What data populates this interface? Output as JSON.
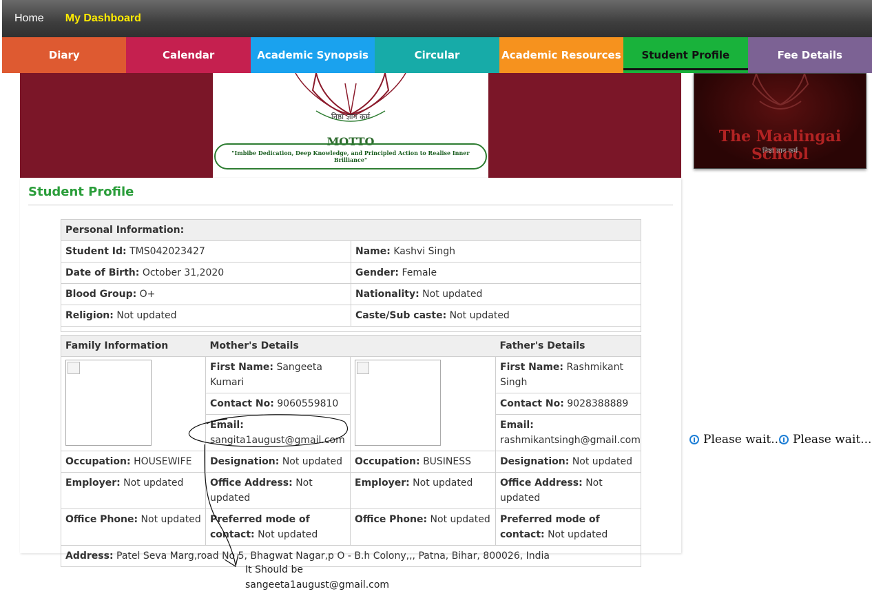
{
  "topbar": {
    "home": "Home",
    "dashboard": "My Dashboard"
  },
  "tabs": [
    {
      "label": "Diary",
      "color": "#de5a31"
    },
    {
      "label": "Calendar",
      "color": "#c5204f"
    },
    {
      "label": "Academic Synopsis",
      "color": "#1aa2ee"
    },
    {
      "label": "Circular",
      "color": "#17aba8"
    },
    {
      "label": "Academic Resources",
      "color": "#f6921e"
    },
    {
      "label": "Student Profile",
      "color": "#19b23b"
    },
    {
      "label": "Fee Details",
      "color": "#7c6294"
    }
  ],
  "banner": {
    "motto_label": "MOTTO",
    "motto_text": "\"Imbibe Dedication, Deep Knowledge, and Principled Action to Realise Inner Brilliance\"",
    "sanskrit": "निष्ठा ज्ञान कर्म"
  },
  "logo": {
    "school_name": "The Maalingai School",
    "tagline": "निष्ठा ज्ञान कर्म"
  },
  "page": {
    "title": "Student Profile"
  },
  "personal": {
    "header": "Personal Information:",
    "student_id_label": "Student Id:",
    "student_id": "TMS042023427",
    "name_label": "Name:",
    "name": "Kashvi Singh",
    "dob_label": "Date of Birth:",
    "dob": "October 31,2020",
    "gender_label": "Gender:",
    "gender": "Female",
    "blood_label": "Blood Group:",
    "blood": "O+",
    "nationality_label": "Nationality:",
    "nationality": "Not updated",
    "religion_label": "Religion:",
    "religion": "Not updated",
    "caste_label": "Caste/Sub caste:",
    "caste": "Not updated"
  },
  "family": {
    "header": "Family Information",
    "mother_header": "Mother's Details",
    "father_header": "Father's Details",
    "mother": {
      "first_name_label": "First Name:",
      "first_name": "Sangeeta Kumari",
      "contact_label": "Contact No:",
      "contact": "9060559810",
      "email_label": "Email:",
      "email": "sangita1august@gmail.com",
      "occupation_label": "Occupation:",
      "occupation": "HOUSEWIFE",
      "designation_label": "Designation:",
      "designation": "Not updated",
      "employer_label": "Employer:",
      "employer": "Not updated",
      "office_address_label": "Office Address:",
      "office_address": "Not updated",
      "office_phone_label": "Office Phone:",
      "office_phone": "Not updated",
      "preferred_label": "Preferred mode of contact:",
      "preferred": "Not updated"
    },
    "father": {
      "first_name_label": "First Name:",
      "first_name": "Rashmikant Singh",
      "contact_label": "Contact No:",
      "contact": "9028388889",
      "email_label": "Email:",
      "email": "rashmikantsingh@gmail.com",
      "occupation_label": "Occupation:",
      "occupation": "BUSINESS",
      "designation_label": "Designation:",
      "designation": "Not updated",
      "employer_label": "Employer:",
      "employer": "Not updated",
      "office_address_label": "Office Address:",
      "office_address": "Not updated",
      "office_phone_label": "Office Phone:",
      "office_phone": "Not updated",
      "preferred_label": "Preferred mode of contact:",
      "preferred": "Not updated"
    },
    "address_label": "Address:",
    "address": "Patel Seva Marg,road No 5, Bhagwat Nagar,p O - B.h Colony,,, Patna, Bihar, 800026, India"
  },
  "status": {
    "wait1": "Please wait...",
    "wait2": "Please wait..."
  },
  "annotation": {
    "line1": "It Should be",
    "line2": "sangeeta1august@gmail.com"
  }
}
